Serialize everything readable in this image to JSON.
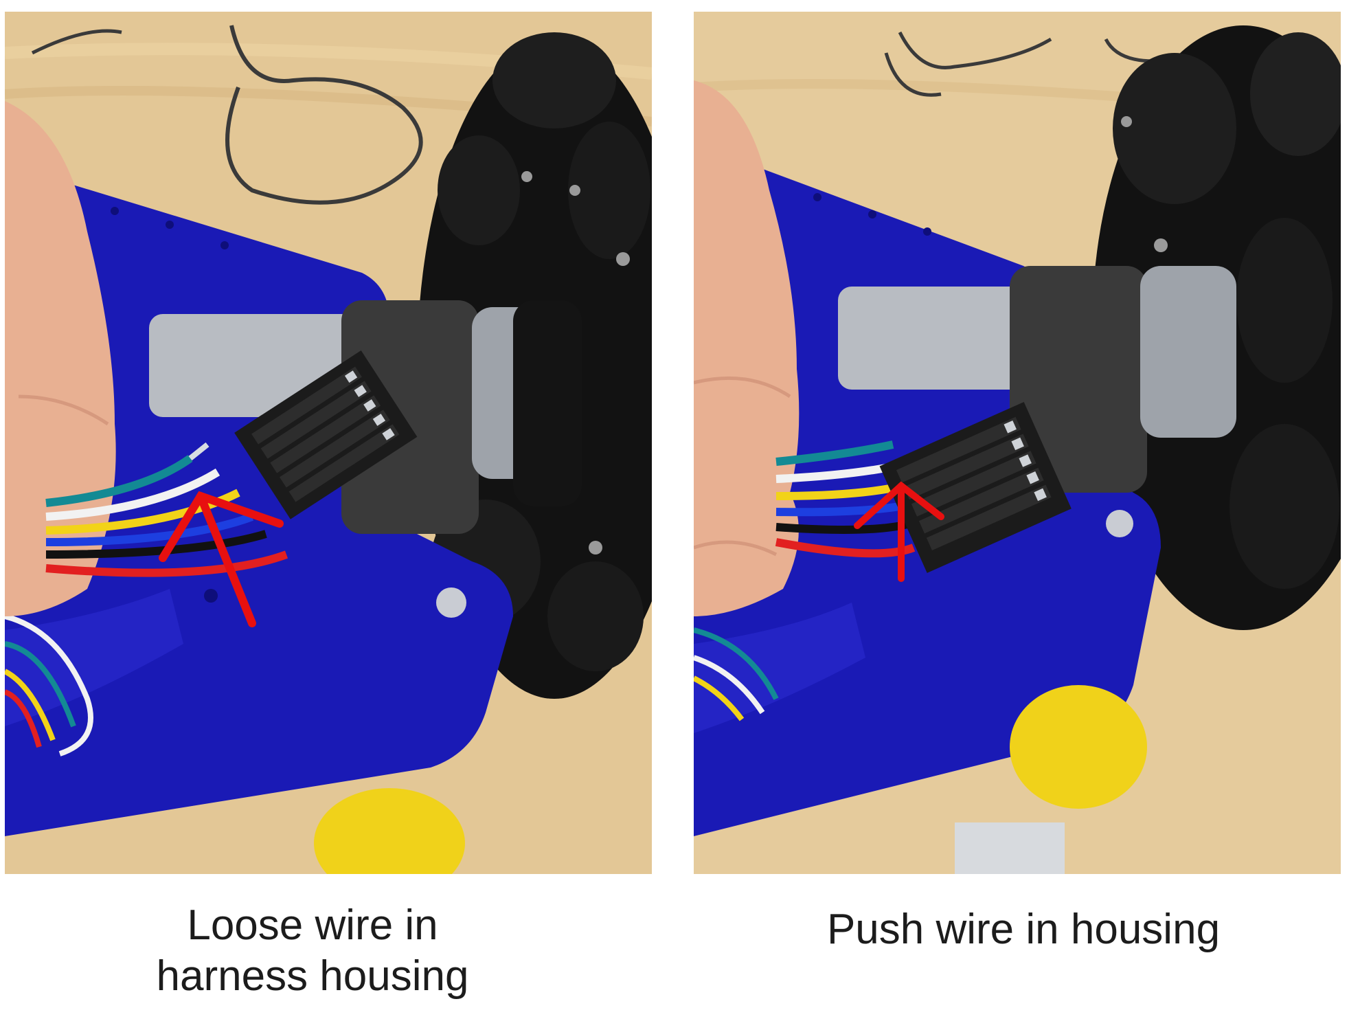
{
  "figure": {
    "panels": [
      {
        "id": "before",
        "caption_lines": [
          "Loose wire in",
          "harness housing"
        ]
      },
      {
        "id": "after",
        "caption_lines": [
          "Push wire in housing"
        ]
      }
    ]
  },
  "colors": {
    "arrow": "#e81010",
    "robot_plate": "#1a1ab5",
    "table_wood": "#e2c694",
    "connector_housing": "#1b1b1b",
    "wheel_rollers": "#141414",
    "motor_metal": "#b8bcc2",
    "foam_sleeve": "#3a3a3a",
    "skin": "#e8b092",
    "yellow_wheel": "#f0d21a",
    "wire_teal": "#138a94",
    "wire_white": "#f2f2f2",
    "wire_yellow": "#f2d318",
    "wire_blue": "#1d3fe0",
    "wire_black": "#111111",
    "wire_red": "#e22020"
  }
}
